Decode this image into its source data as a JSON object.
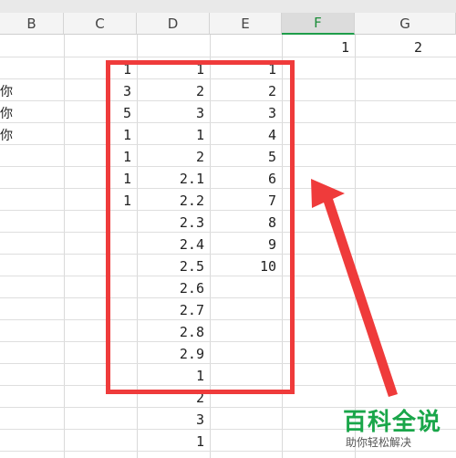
{
  "columns": [
    "B",
    "C",
    "D",
    "E",
    "F",
    "G"
  ],
  "active_column": "F",
  "row1": {
    "F": "1",
    "G": "2"
  },
  "b_values": [
    "你",
    "你",
    "你"
  ],
  "col_c": [
    "1",
    "3",
    "5",
    "1",
    "1",
    "1",
    "1"
  ],
  "col_d": [
    "1",
    "2",
    "3",
    "1",
    "2",
    "2.1",
    "2.2",
    "2.3",
    "2.4",
    "2.5",
    "2.6",
    "2.7",
    "2.8",
    "2.9",
    "1",
    "2",
    "3",
    "1"
  ],
  "col_e": [
    "1",
    "2",
    "3",
    "4",
    "5",
    "6",
    "7",
    "8",
    "9",
    "10"
  ],
  "annotation": {
    "highlight_color": "#ef3b3b",
    "arrow": "arrow-pointing-up-left"
  },
  "watermark": {
    "brand": "百科全说",
    "tagline": "助你轻松解决",
    "brand_color": "#1aa64a"
  }
}
